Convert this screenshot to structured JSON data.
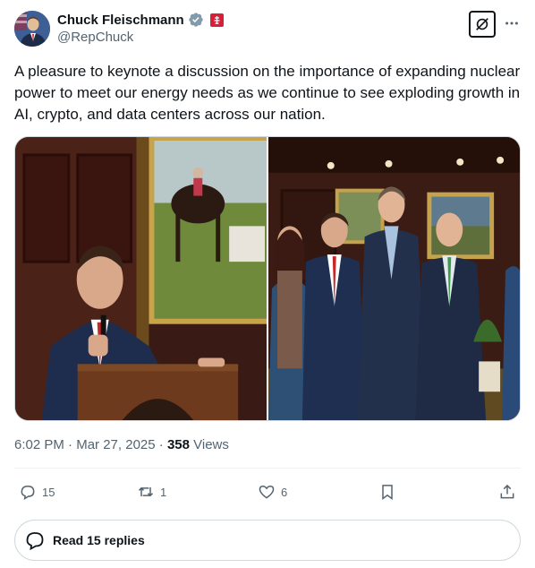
{
  "author": {
    "name": "Chuck Fleischmann",
    "handle": "@RepChuck"
  },
  "tweet": {
    "text": "A pleasure to keynote a discussion on the importance of expanding nuclear power to meet our energy needs as we continue to see exploding growth in AI, crypto, and data centers across our nation.",
    "time": "6:02 PM",
    "separator": " · ",
    "date": "Mar 27, 2025",
    "views_count": "358",
    "views_label": " Views"
  },
  "actions": {
    "replies": "15",
    "reposts": "1",
    "likes": "6"
  },
  "replies_button": {
    "label": "Read 15 replies"
  },
  "icons": {
    "verified": "verified-badge-icon",
    "flag": "government-affiliation-icon",
    "grok": "grok-icon",
    "more": "more-icon",
    "reply": "reply-icon",
    "repost": "repost-icon",
    "like": "heart-icon",
    "bookmark": "bookmark-icon",
    "share": "share-icon"
  },
  "colors": {
    "text_primary": "#0f1419",
    "text_secondary": "#536471",
    "verified": "#829aab",
    "border": "#cfd9de",
    "divider": "#eff3f4"
  }
}
